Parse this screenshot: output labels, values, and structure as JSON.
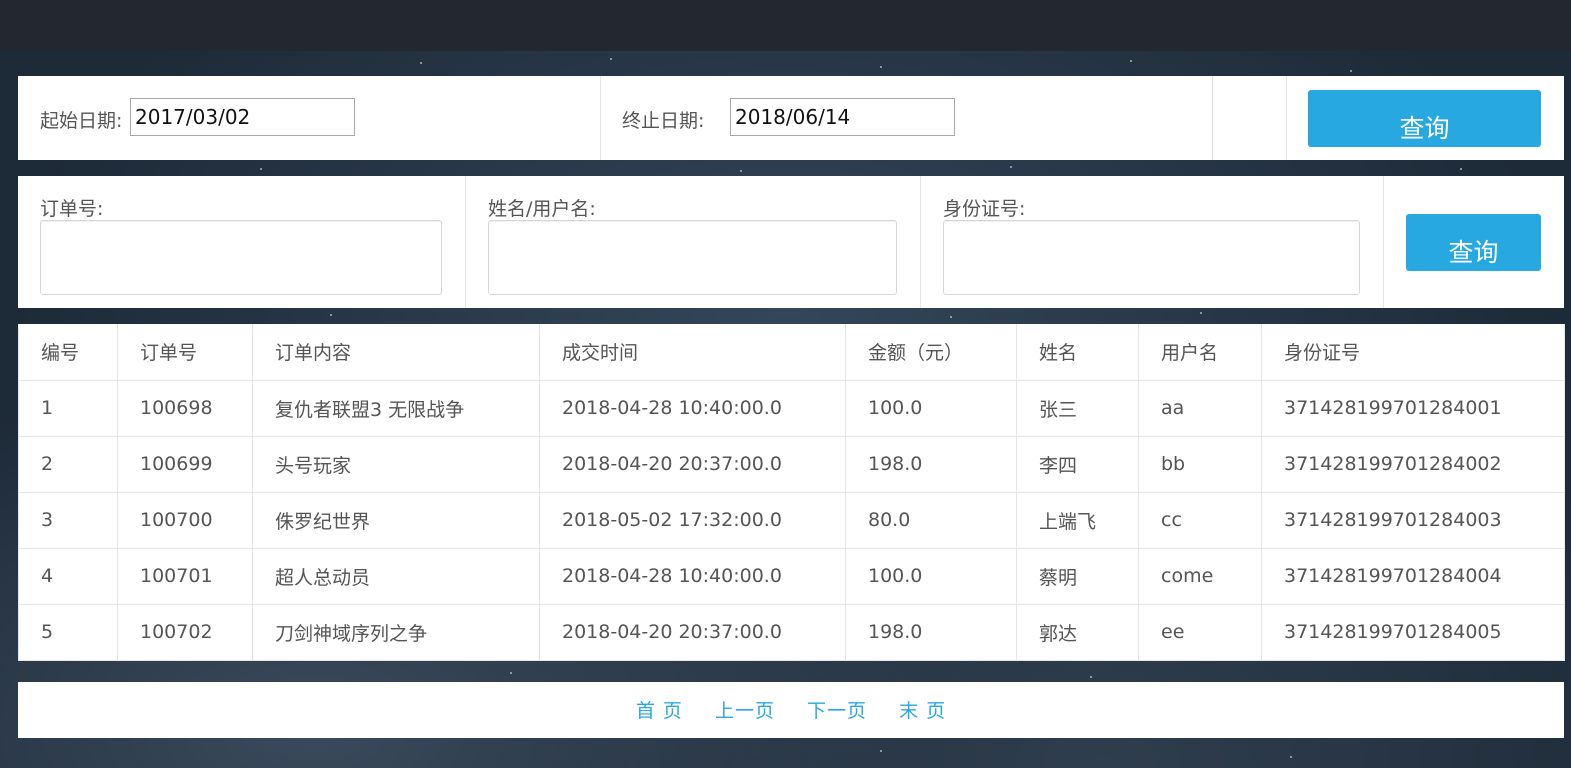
{
  "search_dates": {
    "start_label": "起始日期:",
    "start_value": "2017/03/02",
    "end_label": "终止日期:",
    "end_value": "2018/06/14",
    "button_label": "查询"
  },
  "search_fields": {
    "order_no_label": "订单号:",
    "name_label": "姓名/用户名:",
    "id_label": "身份证号:",
    "button_label": "查询"
  },
  "table": {
    "headers": [
      "编号",
      "订单号",
      "订单内容",
      "成交时间",
      "金额（元）",
      "姓名",
      "用户名",
      "身份证号"
    ],
    "rows": [
      [
        "1",
        "100698",
        "复仇者联盟3 无限战争",
        "2018-04-28 10:40:00.0",
        "100.0",
        "张三",
        "aa",
        "371428199701284001"
      ],
      [
        "2",
        "100699",
        "头号玩家",
        "2018-04-20 20:37:00.0",
        "198.0",
        "李四",
        "bb",
        "371428199701284002"
      ],
      [
        "3",
        "100700",
        "侏罗纪世界",
        "2018-05-02 17:32:00.0",
        "80.0",
        "上端飞",
        "cc",
        "371428199701284003"
      ],
      [
        "4",
        "100701",
        "超人总动员",
        "2018-04-28 10:40:00.0",
        "100.0",
        "蔡明",
        "come",
        "371428199701284004"
      ],
      [
        "5",
        "100702",
        "刀剑神域序列之争",
        "2018-04-20 20:37:00.0",
        "198.0",
        "郭达",
        "ee",
        "371428199701284005"
      ]
    ]
  },
  "pager": {
    "first": "首 页",
    "prev": "上一页",
    "next": "下一页",
    "last": "末 页"
  },
  "colors": {
    "accent": "#27a8e0",
    "topbar": "#222730"
  }
}
